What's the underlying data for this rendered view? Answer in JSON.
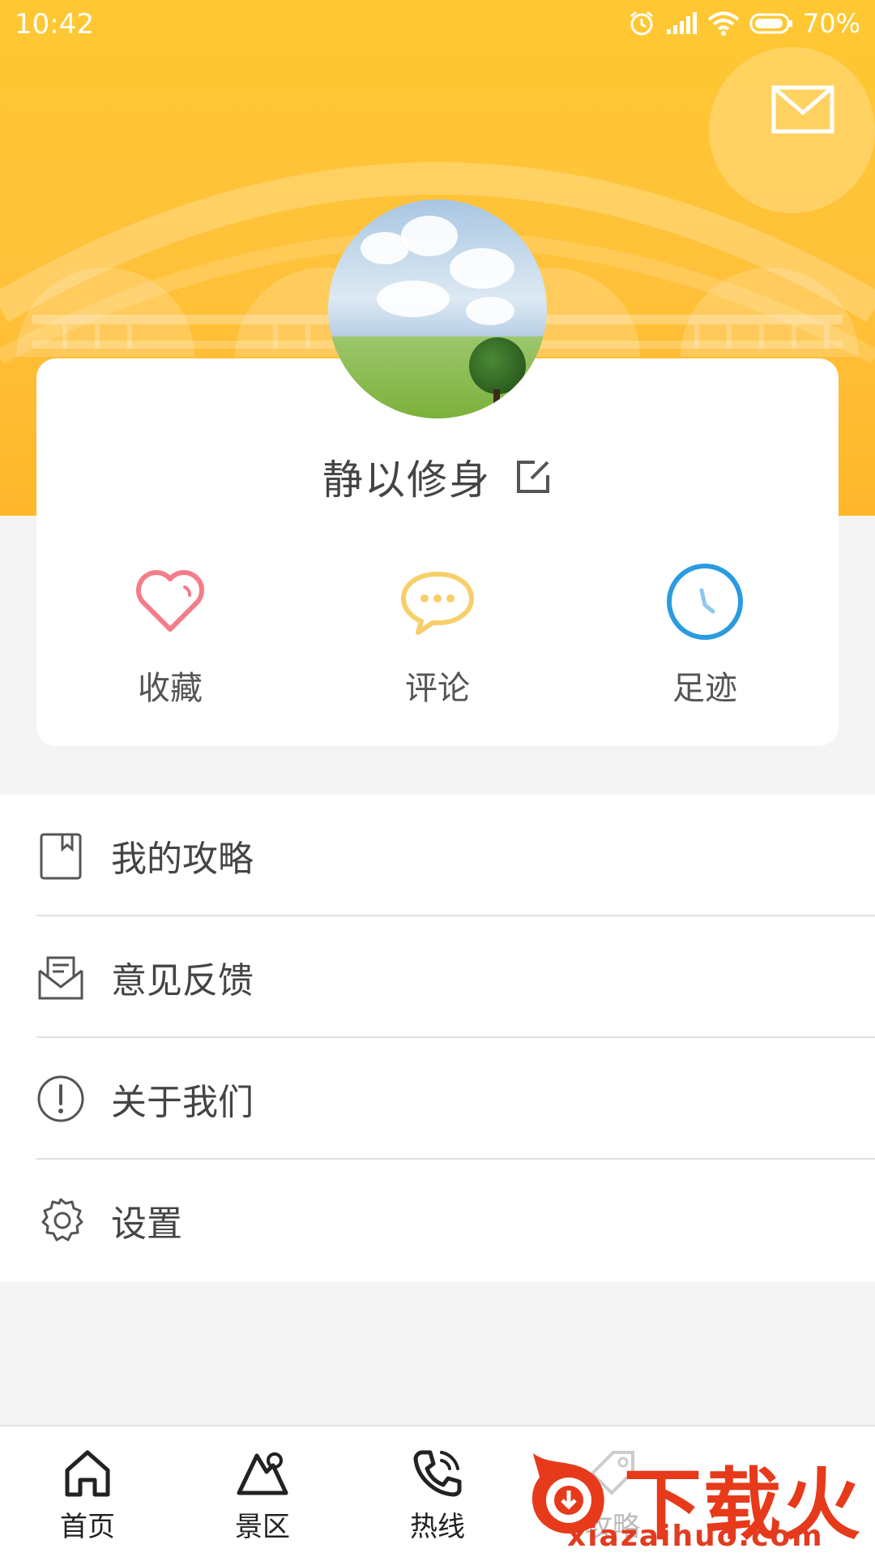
{
  "status_bar": {
    "time": "10:42",
    "battery_percent": "70%",
    "icons": [
      "alarm-icon",
      "signal-icon",
      "wifi-icon",
      "battery-icon"
    ]
  },
  "header": {
    "mail_icon": "mail-icon",
    "colors": {
      "gradient_top": "#ffc832",
      "gradient_bottom": "#ffb72a"
    }
  },
  "profile": {
    "username": "静以修身",
    "edit_icon": "edit-icon"
  },
  "stats": [
    {
      "label": "收藏",
      "icon": "heart-icon",
      "color": "#f47d8a"
    },
    {
      "label": "评论",
      "icon": "comment-icon",
      "color": "#f7cf6a"
    },
    {
      "label": "足迹",
      "icon": "clock-icon",
      "color": "#2a9be0"
    }
  ],
  "menu": [
    {
      "label": "我的攻略",
      "icon": "guide-book-icon"
    },
    {
      "label": "意见反馈",
      "icon": "feedback-mail-icon"
    },
    {
      "label": "关于我们",
      "icon": "info-icon"
    },
    {
      "label": "设置",
      "icon": "gear-icon"
    }
  ],
  "tabbar": [
    {
      "label": "首页",
      "icon": "home-icon"
    },
    {
      "label": "景区",
      "icon": "mountain-icon"
    },
    {
      "label": "热线",
      "icon": "phone-icon"
    },
    {
      "label": "攻略",
      "icon": "tag-icon"
    }
  ],
  "watermark": {
    "brand": "下载火",
    "url": "xiazaihuo.com"
  }
}
